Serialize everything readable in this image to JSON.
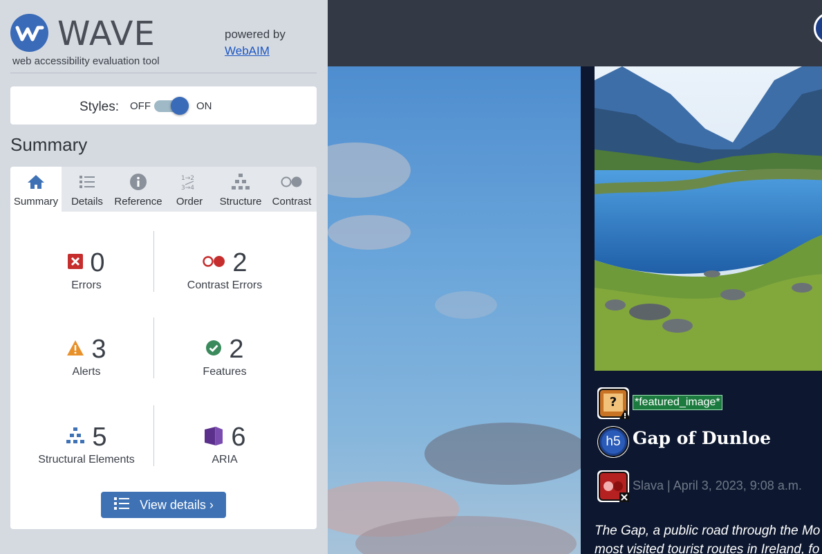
{
  "wave": {
    "logo_text": "WAVE",
    "tagline": "web accessibility evaluation tool",
    "powered_by": "powered by",
    "webaim_link": "WebAIM"
  },
  "styles_toggle": {
    "label": "Styles:",
    "off": "OFF",
    "on": "ON",
    "state": "on"
  },
  "summary_heading": "Summary",
  "tabs": [
    {
      "label": "Summary",
      "icon": "home-icon",
      "active": true
    },
    {
      "label": "Details",
      "icon": "list-icon",
      "active": false
    },
    {
      "label": "Reference",
      "icon": "info-icon",
      "active": false
    },
    {
      "label": "Order",
      "icon": "order-icon",
      "active": false
    },
    {
      "label": "Structure",
      "icon": "structure-icon",
      "active": false
    },
    {
      "label": "Contrast",
      "icon": "contrast-icon",
      "active": false
    }
  ],
  "stats": {
    "errors": {
      "value": "0",
      "label": "Errors"
    },
    "contrast_errors": {
      "value": "2",
      "label": "Contrast Errors"
    },
    "alerts": {
      "value": "3",
      "label": "Alerts"
    },
    "features": {
      "value": "2",
      "label": "Features"
    },
    "structural": {
      "value": "5",
      "label": "Structural Elements"
    },
    "aria": {
      "value": "6",
      "label": "ARIA"
    }
  },
  "view_details": "View details ›",
  "page": {
    "featured_tag": "*featured_image*",
    "h5_badge": "h5",
    "title": "Gap of Dunloe",
    "meta": "Slava | April 3, 2023, 9:08 a.m.",
    "excerpt_line1": "The Gap, a public road through the Mo",
    "excerpt_line2": "most visited tourist routes in Ireland, fo"
  },
  "colors": {
    "accent": "#3a6bb8",
    "error": "#c62d2d",
    "alert": "#e8912b",
    "feature": "#3a8a5c",
    "structure": "#3e72b5",
    "aria": "#5b2f8c"
  }
}
